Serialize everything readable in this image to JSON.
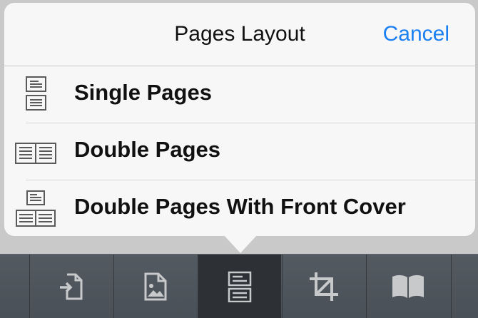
{
  "popover": {
    "title": "Pages Layout",
    "cancel_label": "Cancel",
    "options": [
      {
        "label": "Single Pages",
        "icon": "single-pages-icon"
      },
      {
        "label": "Double Pages",
        "icon": "double-pages-icon"
      },
      {
        "label": "Double Pages With Front Cover",
        "icon": "double-pages-front-cover-icon"
      }
    ]
  },
  "toolbar": {
    "items": [
      {
        "icon": "import-icon",
        "selected": false
      },
      {
        "icon": "image-file-icon",
        "selected": false
      },
      {
        "icon": "pages-layout-icon",
        "selected": true
      },
      {
        "icon": "crop-icon",
        "selected": false
      },
      {
        "icon": "book-icon",
        "selected": false
      }
    ]
  },
  "colors": {
    "accent": "#1a7ff0",
    "popover_bg": "#f7f7f7",
    "toolbar_bg": "#4e545b",
    "toolbar_selected": "#2d3136",
    "icon_gray": "#5a5a5a",
    "toolbar_icon": "#c7c9cb"
  }
}
